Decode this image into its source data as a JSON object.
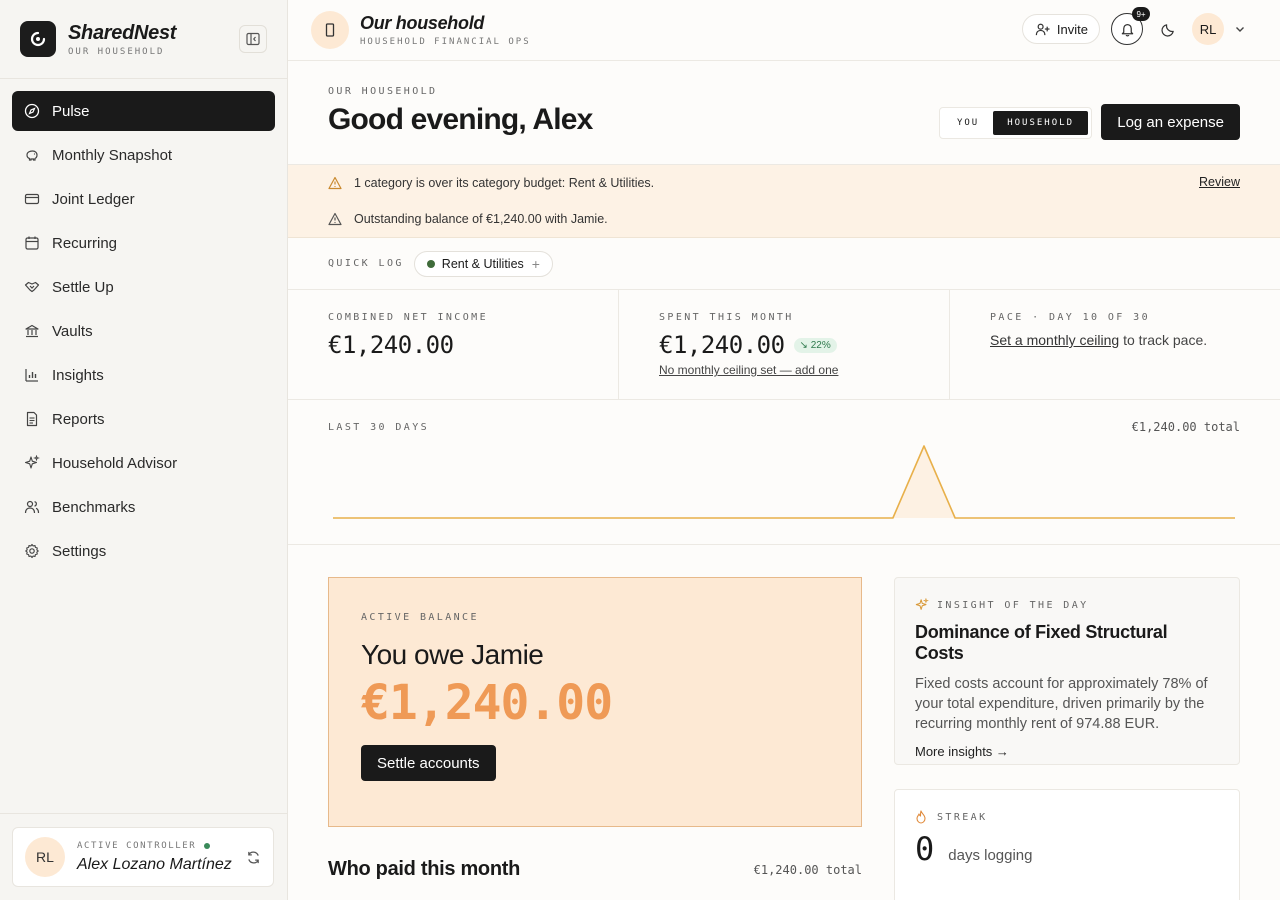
{
  "brand": {
    "name": "SharedNest",
    "sub": "OUR HOUSEHOLD"
  },
  "nav": {
    "items": [
      {
        "label": "Pulse",
        "icon": "compass-icon"
      },
      {
        "label": "Monthly Snapshot",
        "icon": "piggy-bank-icon"
      },
      {
        "label": "Joint Ledger",
        "icon": "card-icon"
      },
      {
        "label": "Recurring",
        "icon": "calendar-icon"
      },
      {
        "label": "Settle Up",
        "icon": "handshake-icon"
      },
      {
        "label": "Vaults",
        "icon": "bank-icon"
      },
      {
        "label": "Insights",
        "icon": "bar-chart-icon"
      },
      {
        "label": "Reports",
        "icon": "document-icon"
      },
      {
        "label": "Household Advisor",
        "icon": "sparkles-icon"
      },
      {
        "label": "Benchmarks",
        "icon": "users-icon"
      },
      {
        "label": "Settings",
        "icon": "gear-icon"
      }
    ]
  },
  "controller": {
    "initials": "RL",
    "label": "ACTIVE CONTROLLER",
    "name": "Alex Lozano Martínez"
  },
  "topbar": {
    "title": "Our household",
    "sub": "HOUSEHOLD FINANCIAL OPS",
    "invite": "Invite",
    "badge": "9+",
    "initials": "RL"
  },
  "hero": {
    "eyebrow": "OUR HOUSEHOLD",
    "greeting": "Good evening, Alex",
    "toggle_you": "YOU",
    "toggle_household": "HOUSEHOLD",
    "log_button": "Log an expense"
  },
  "alerts": {
    "items": [
      "1 category is over its category budget: Rent & Utilities.",
      "Outstanding balance of €1,240.00 with Jamie."
    ],
    "review": "Review"
  },
  "quick_log": {
    "label": "QUICK LOG",
    "chip": "Rent & Utilities",
    "chip_color": "#3f6b3a"
  },
  "stats": {
    "income_label": "COMBINED NET INCOME",
    "income_value": "€1,240.00",
    "spent_label": "SPENT THIS MONTH",
    "spent_value": "€1,240.00",
    "spent_change": "22%",
    "spent_link": "No monthly ceiling set — add one",
    "pace_label": "PACE · DAY 10 OF 30",
    "pace_link": "Set a monthly ceiling",
    "pace_rest": " to track pace."
  },
  "trend": {
    "label": "LAST 30 DAYS",
    "total": "€1,240.00 total"
  },
  "chart_data": {
    "type": "area",
    "x": [
      1,
      2,
      3,
      4,
      5,
      6,
      7,
      8,
      9,
      10,
      11,
      12,
      13,
      14,
      15,
      16,
      17,
      18,
      19,
      20,
      21,
      22,
      23,
      24,
      25,
      26,
      27,
      28,
      29,
      30
    ],
    "values": [
      0,
      0,
      0,
      0,
      0,
      0,
      0,
      0,
      0,
      0,
      0,
      0,
      0,
      0,
      0,
      0,
      0,
      0,
      0,
      1240,
      0,
      0,
      0,
      0,
      0,
      0,
      0,
      0,
      0,
      0
    ],
    "color": "#e8b04a",
    "fill": "#fdf1e3"
  },
  "balance": {
    "eyebrow": "ACTIVE BALANCE",
    "title": "You owe Jamie",
    "amount": "€1,240.00",
    "button": "Settle accounts",
    "accent": "#ef9a56"
  },
  "insight": {
    "eyebrow": "INSIGHT OF THE DAY",
    "title": "Dominance of Fixed Structural Costs",
    "body": "Fixed costs account for approximately 78% of your total expenditure, driven primarily by the recurring monthly rent of 974.88 EUR.",
    "more": "More insights →"
  },
  "streak": {
    "eyebrow": "STREAK",
    "value": "0",
    "label": "days logging"
  },
  "who": {
    "title": "Who paid this month",
    "total": "€1,240.00 total"
  }
}
